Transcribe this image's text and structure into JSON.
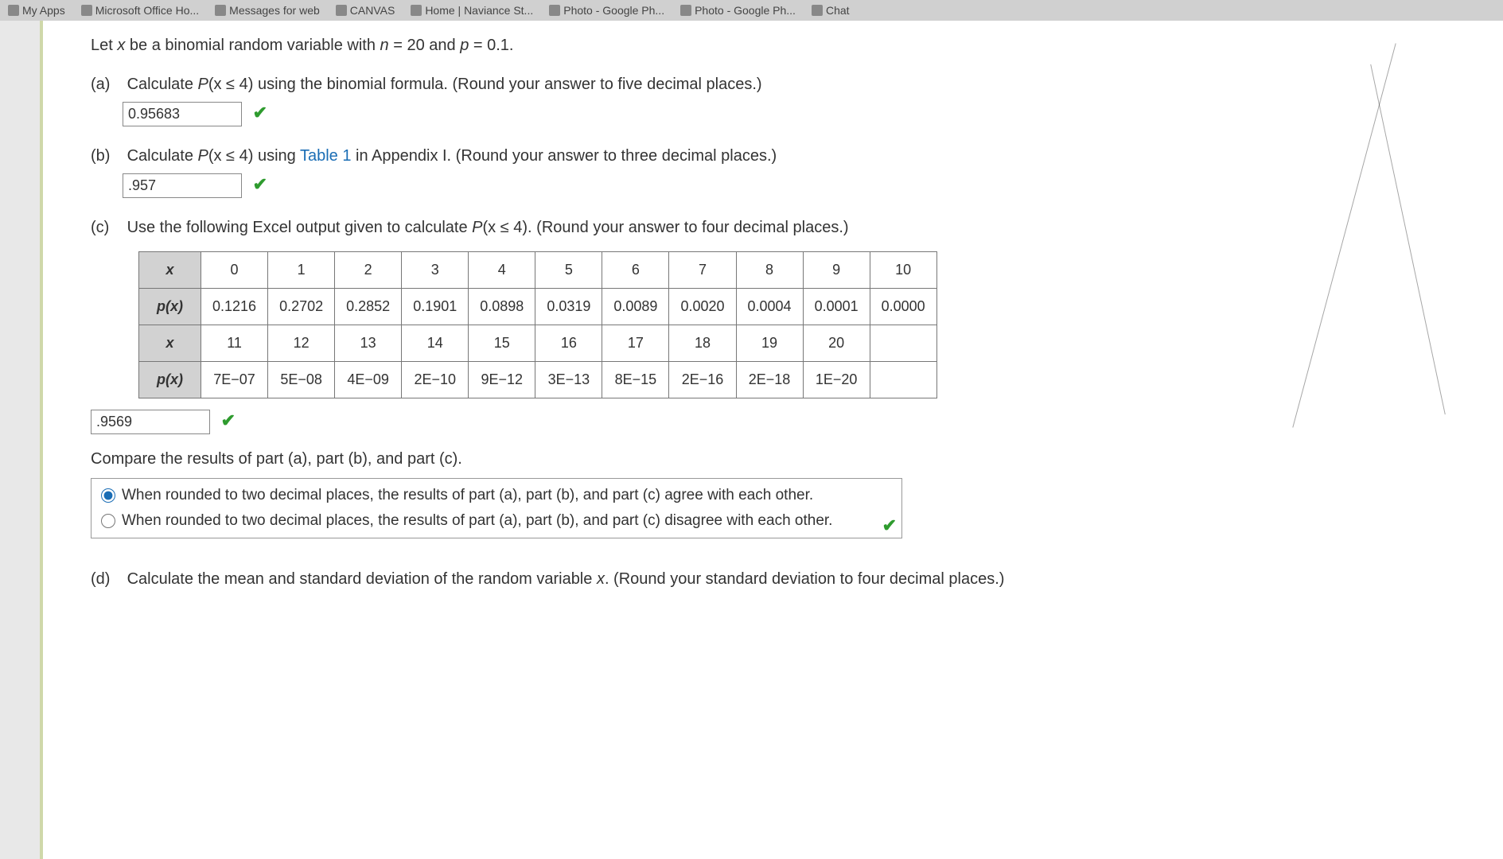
{
  "bookmarks": [
    "My Apps",
    "Microsoft Office Ho...",
    "Messages for web",
    "CANVAS",
    "Home | Naviance St...",
    "Photo - Google Ph...",
    "Photo - Google Ph...",
    "Chat"
  ],
  "intro_pre": "Let ",
  "intro_var": "x",
  "intro_mid": " be a binomial random variable with ",
  "intro_n": "n",
  "intro_eq1": " = 20 and ",
  "intro_p": "p",
  "intro_eq2": " = 0.1.",
  "a": {
    "label": "(a)",
    "text_pre": "Calculate ",
    "text_fun": "P",
    "text_arg": "(x ≤ 4)",
    "text_post": " using the binomial formula. (Round your answer to five decimal places.)",
    "answer": "0.95683"
  },
  "b": {
    "label": "(b)",
    "text_pre": "Calculate ",
    "text_fun": "P",
    "text_arg": "(x ≤ 4)",
    "text_mid": " using ",
    "link": "Table 1",
    "text_post": " in Appendix I. (Round your answer to three decimal places.)",
    "answer": ".957"
  },
  "c": {
    "label": "(c)",
    "text_pre": "Use the following Excel output given to calculate ",
    "text_fun": "P",
    "text_arg": "(x ≤ 4)",
    "text_post": ". (Round your answer to four decimal places.)",
    "answer": ".9569",
    "compare": "Compare the results of part (a), part (b), and part (c).",
    "opt1": "When rounded to two decimal places, the results of part (a), part (b), and part (c) agree with each other.",
    "opt2": "When rounded to two decimal places, the results of part (a), part (b), and part (c) disagree with each other."
  },
  "table": {
    "r1h": "x",
    "r1": [
      "0",
      "1",
      "2",
      "3",
      "4",
      "5",
      "6",
      "7",
      "8",
      "9",
      "10"
    ],
    "r2h": "p(x)",
    "r2": [
      "0.1216",
      "0.2702",
      "0.2852",
      "0.1901",
      "0.0898",
      "0.0319",
      "0.0089",
      "0.0020",
      "0.0004",
      "0.0001",
      "0.0000"
    ],
    "r3h": "x",
    "r3": [
      "11",
      "12",
      "13",
      "14",
      "15",
      "16",
      "17",
      "18",
      "19",
      "20",
      ""
    ],
    "r4h": "p(x)",
    "r4": [
      "7E−07",
      "5E−08",
      "4E−09",
      "2E−10",
      "9E−12",
      "3E−13",
      "8E−15",
      "2E−16",
      "2E−18",
      "1E−20",
      ""
    ]
  },
  "d": {
    "label": "(d)",
    "text_pre": "Calculate the mean and standard deviation of the random variable ",
    "text_var": "x",
    "text_post": ". (Round your standard deviation to four decimal places.)"
  }
}
